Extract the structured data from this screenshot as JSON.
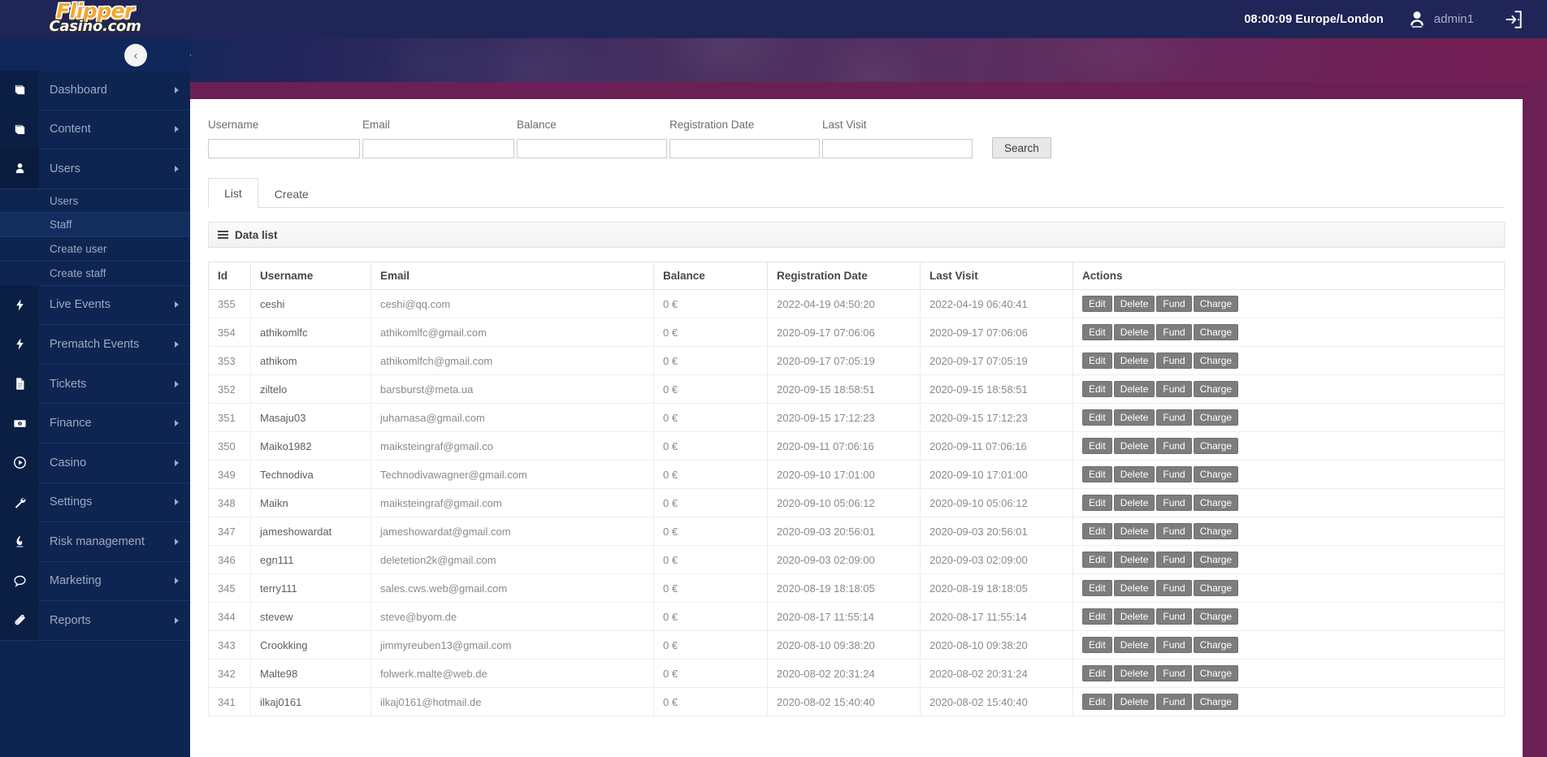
{
  "brand": {
    "logo_line1": "Flipper",
    "logo_line2": "Casino.com",
    "logo_color_primary": "#f0a830",
    "logo_color_secondary": "#ffffff"
  },
  "topbar": {
    "clock": "08:00:09 Europe/London",
    "username": "admin1",
    "avatar_icon": "user-avatar-icon",
    "logout_icon": "logout-door-icon"
  },
  "breadcrumb": {
    "home_icon": "home-icon",
    "collapse_icon": "chevron-left-icon"
  },
  "sidebar": {
    "items": [
      {
        "label": "Dashboard",
        "icon": "book-icon",
        "has_caret": true,
        "active": false
      },
      {
        "label": "Content",
        "icon": "book-icon",
        "has_caret": true,
        "active": false
      },
      {
        "label": "Users",
        "icon": "user-icon",
        "has_caret": true,
        "active": true
      },
      {
        "label": "Live Events",
        "icon": "bolt-icon",
        "has_caret": true,
        "active": false
      },
      {
        "label": "Prematch Events",
        "icon": "bolt-icon",
        "has_caret": true,
        "active": false
      },
      {
        "label": "Tickets",
        "icon": "file-icon",
        "has_caret": true,
        "active": false
      },
      {
        "label": "Finance",
        "icon": "money-icon",
        "has_caret": true,
        "active": false
      },
      {
        "label": "Casino",
        "icon": "play-circle-icon",
        "has_caret": true,
        "active": false
      },
      {
        "label": "Settings",
        "icon": "wrench-icon",
        "has_caret": true,
        "active": false
      },
      {
        "label": "Risk management",
        "icon": "fire-icon",
        "has_caret": true,
        "active": false
      },
      {
        "label": "Marketing",
        "icon": "chat-icon",
        "has_caret": true,
        "active": false
      },
      {
        "label": "Reports",
        "icon": "paperclip-icon",
        "has_caret": true,
        "active": false
      }
    ],
    "subitems": [
      {
        "label": "Users",
        "active": false
      },
      {
        "label": "Staff",
        "active": true
      },
      {
        "label": "Create user",
        "active": false
      },
      {
        "label": "Create staff",
        "active": false
      }
    ]
  },
  "filters": {
    "fields": [
      {
        "label": "Username",
        "value": "",
        "placeholder": ""
      },
      {
        "label": "Email",
        "value": "",
        "placeholder": ""
      },
      {
        "label": "Balance",
        "value": "",
        "placeholder": ""
      },
      {
        "label": "Registration Date",
        "value": "",
        "placeholder": ""
      },
      {
        "label": "Last Visit",
        "value": "",
        "placeholder": ""
      }
    ],
    "search_button": "Search"
  },
  "tabs": [
    {
      "label": "List",
      "active": true
    },
    {
      "label": "Create",
      "active": false
    }
  ],
  "panel": {
    "title": "Data list",
    "menu_icon": "hamburger-icon"
  },
  "table": {
    "columns": [
      "Id",
      "Username",
      "Email",
      "Balance",
      "Registration Date",
      "Last Visit",
      "Actions"
    ],
    "row_actions": [
      "Edit",
      "Delete",
      "Fund",
      "Charge"
    ],
    "rows": [
      {
        "id": "355",
        "username": "ceshi",
        "email": "ceshi@qq.com",
        "balance": "0 €",
        "registration": "2022-04-19 04:50:20",
        "last_visit": "2022-04-19 06:40:41"
      },
      {
        "id": "354",
        "username": "athikomlfc",
        "email": "athikomlfc@gmail.com",
        "balance": "0 €",
        "registration": "2020-09-17 07:06:06",
        "last_visit": "2020-09-17 07:06:06"
      },
      {
        "id": "353",
        "username": "athikom",
        "email": "athikomlfch@gmail.com",
        "balance": "0 €",
        "registration": "2020-09-17 07:05:19",
        "last_visit": "2020-09-17 07:05:19"
      },
      {
        "id": "352",
        "username": "ziltelo",
        "email": "barsburst@meta.ua",
        "balance": "0 €",
        "registration": "2020-09-15 18:58:51",
        "last_visit": "2020-09-15 18:58:51"
      },
      {
        "id": "351",
        "username": "Masaju03",
        "email": "juhamasa@gmail.com",
        "balance": "0 €",
        "registration": "2020-09-15 17:12:23",
        "last_visit": "2020-09-15 17:12:23"
      },
      {
        "id": "350",
        "username": "Maiko1982",
        "email": "maiksteingraf@gmail.co",
        "balance": "0 €",
        "registration": "2020-09-11 07:06:16",
        "last_visit": "2020-09-11 07:06:16"
      },
      {
        "id": "349",
        "username": "Technodiva",
        "email": "Technodivawagner@gmail.com",
        "balance": "0 €",
        "registration": "2020-09-10 17:01:00",
        "last_visit": "2020-09-10 17:01:00"
      },
      {
        "id": "348",
        "username": "Maikn",
        "email": "maiksteingraf@gmail.com",
        "balance": "0 €",
        "registration": "2020-09-10 05:06:12",
        "last_visit": "2020-09-10 05:06:12"
      },
      {
        "id": "347",
        "username": "jameshowardat",
        "email": "jameshowardat@gmail.com",
        "balance": "0 €",
        "registration": "2020-09-03 20:56:01",
        "last_visit": "2020-09-03 20:56:01"
      },
      {
        "id": "346",
        "username": "egn111",
        "email": "deletetion2k@gmail.com",
        "balance": "0 €",
        "registration": "2020-09-03 02:09:00",
        "last_visit": "2020-09-03 02:09:00"
      },
      {
        "id": "345",
        "username": "terry111",
        "email": "sales.cws.web@gmail.com",
        "balance": "0 €",
        "registration": "2020-08-19 18:18:05",
        "last_visit": "2020-08-19 18:18:05"
      },
      {
        "id": "344",
        "username": "stevew",
        "email": "steve@byom.de",
        "balance": "0 €",
        "registration": "2020-08-17 11:55:14",
        "last_visit": "2020-08-17 11:55:14"
      },
      {
        "id": "343",
        "username": "Crookking",
        "email": "jimmyreuben13@gmail.com",
        "balance": "0 €",
        "registration": "2020-08-10 09:38:20",
        "last_visit": "2020-08-10 09:38:20"
      },
      {
        "id": "342",
        "username": "Malte98",
        "email": "folwerk.malte@web.de",
        "balance": "0 €",
        "registration": "2020-08-02 20:31:24",
        "last_visit": "2020-08-02 20:31:24"
      },
      {
        "id": "341",
        "username": "ilkaj0161",
        "email": "ilkaj0161@hotmail.de",
        "balance": "0 €",
        "registration": "2020-08-02 15:40:40",
        "last_visit": "2020-08-02 15:40:40"
      }
    ]
  },
  "colors": {
    "topbar": "#1f2557",
    "sidebar": "#0d2550",
    "page_bg": "#6b2055",
    "accent_orange": "#f0a830",
    "action_button": "#7d7d7d"
  }
}
